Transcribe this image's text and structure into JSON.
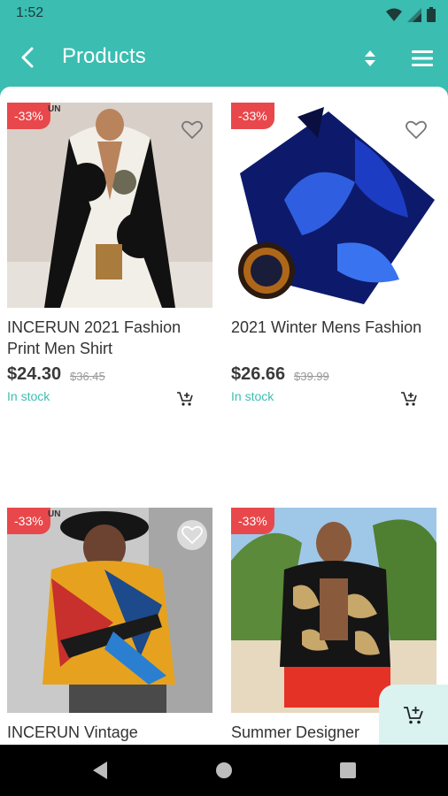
{
  "status_bar": {
    "time": "1:52"
  },
  "app_bar": {
    "title": "Products"
  },
  "products": [
    {
      "name": "INCERUN 2021 Fashion Print Men Shirt",
      "price": "$24.30",
      "old_price": "$36.45",
      "badge": "-33%",
      "stock": "In stock",
      "image_text": "UN"
    },
    {
      "name": "2021 Winter Mens Fashion",
      "price": "$26.66",
      "old_price": "$39.99",
      "badge": "-33%",
      "stock": "In stock"
    },
    {
      "name": "INCERUN Vintage",
      "badge": "-33%",
      "image_text": "UN"
    },
    {
      "name": "Summer Designer",
      "badge": "-33%"
    }
  ],
  "colors": {
    "accent": "#3bbdb1",
    "badge": "#e8484b",
    "fab_bg": "#daf3f1"
  },
  "icons": {
    "back": "arrow-left-icon",
    "sort": "sort-icon",
    "menu": "hamburger-menu-icon",
    "favorite": "heart-outline-icon",
    "cart": "add-to-cart-icon"
  }
}
